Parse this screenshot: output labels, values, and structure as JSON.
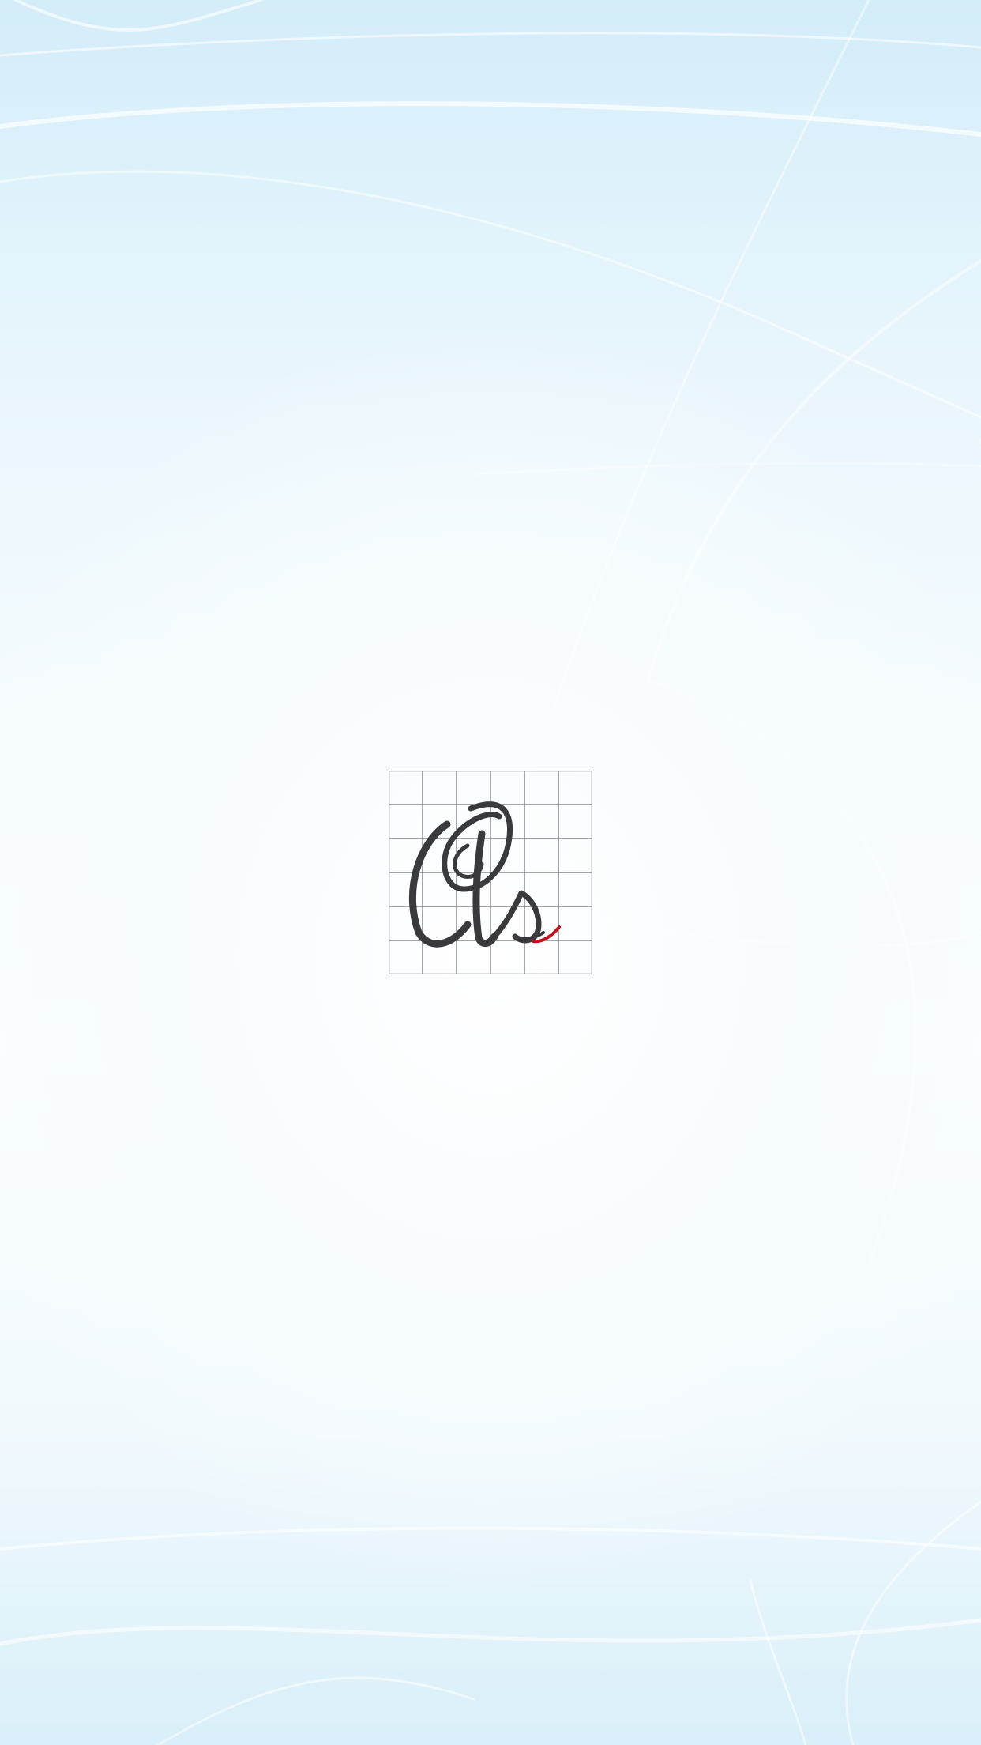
{
  "screen": {
    "name": "splash-screen",
    "background_color": "#eaf6fc",
    "accent_color": "#c1121f"
  },
  "logo": {
    "text": "Qls",
    "ink_color": "#3a3a3c",
    "grid_color": "#6e6e72",
    "accent_color": "#c1121f",
    "icon": "monogram-logo"
  }
}
